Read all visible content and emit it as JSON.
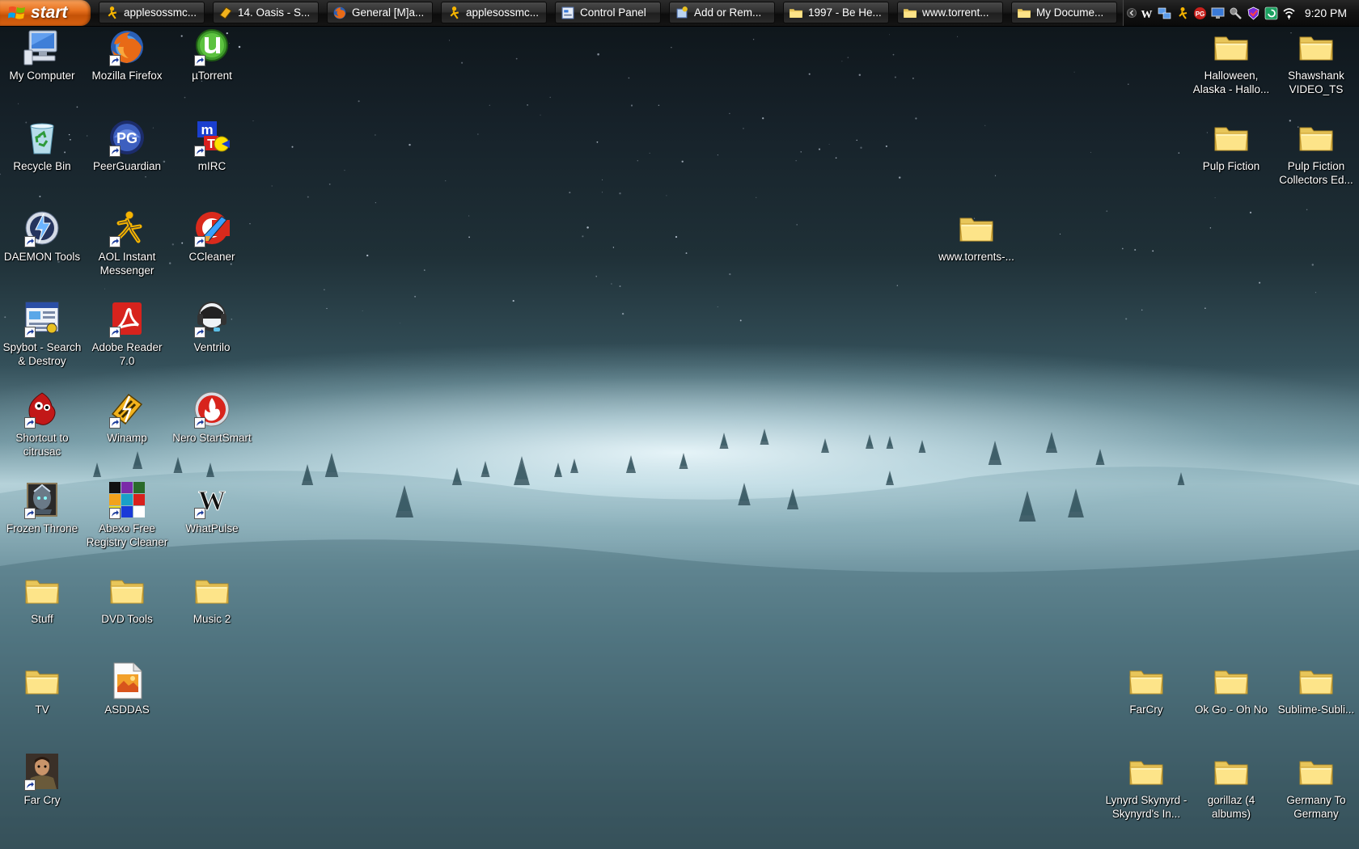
{
  "taskbar": {
    "start_label": "start",
    "buttons": [
      {
        "label": "applesossmc...",
        "icon": "aim-icon"
      },
      {
        "label": "14. Oasis - S...",
        "icon": "winamp-icon"
      },
      {
        "label": "General [M]a...",
        "icon": "firefox-icon"
      },
      {
        "label": "applesossmc...",
        "icon": "aim-chat-icon"
      },
      {
        "label": "Control Panel",
        "icon": "control-panel-icon"
      },
      {
        "label": "Add or Rem...",
        "icon": "add-remove-icon"
      },
      {
        "label": "1997 - Be He...",
        "icon": "folder-icon"
      },
      {
        "label": "www.torrent...",
        "icon": "folder-icon"
      },
      {
        "label": "My Docume...",
        "icon": "folder-icon"
      }
    ],
    "tray": {
      "icons": [
        "whatpulse-icon",
        "network-icon",
        "aim-icon",
        "peerguardian-icon",
        "monitor-icon",
        "antivirus-icon",
        "security-icon",
        "update-icon",
        "wireless-icon"
      ],
      "clock": "9:20 PM"
    }
  },
  "desktop": {
    "icons": [
      {
        "label": "My Computer",
        "icon": "my-computer-icon",
        "shortcut": false
      },
      {
        "label": "Mozilla Firefox",
        "icon": "firefox-icon",
        "shortcut": true
      },
      {
        "label": "µTorrent",
        "icon": "utorrent-icon",
        "shortcut": true
      },
      {
        "label": "Recycle Bin",
        "icon": "recycle-bin-icon",
        "shortcut": false
      },
      {
        "label": "PeerGuardian",
        "icon": "peerguardian-icon",
        "shortcut": true
      },
      {
        "label": "mIRC",
        "icon": "mirc-icon",
        "shortcut": true
      },
      {
        "label": "DAEMON Tools",
        "icon": "daemon-tools-icon",
        "shortcut": true
      },
      {
        "label": "AOL Instant Messenger",
        "icon": "aim-icon",
        "shortcut": true
      },
      {
        "label": "CCleaner",
        "icon": "ccleaner-icon",
        "shortcut": true
      },
      {
        "label": "Spybot - Search & Destroy",
        "icon": "spybot-icon",
        "shortcut": true
      },
      {
        "label": "Adobe Reader 7.0",
        "icon": "adobe-reader-icon",
        "shortcut": true
      },
      {
        "label": "Ventrilo",
        "icon": "ventrilo-icon",
        "shortcut": true
      },
      {
        "label": "Shortcut to citrusac",
        "icon": "citrusac-icon",
        "shortcut": true
      },
      {
        "label": "Winamp",
        "icon": "winamp-icon",
        "shortcut": true
      },
      {
        "label": "Nero StartSmart",
        "icon": "nero-icon",
        "shortcut": true
      },
      {
        "label": "Frozen Throne",
        "icon": "frozen-throne-icon",
        "shortcut": true
      },
      {
        "label": "Abexo Free Registry Cleaner",
        "icon": "registry-cleaner-icon",
        "shortcut": true
      },
      {
        "label": "WhatPulse",
        "icon": "whatpulse-icon",
        "shortcut": true
      },
      {
        "label": "Stuff",
        "icon": "folder-icon",
        "shortcut": false
      },
      {
        "label": "DVD Tools",
        "icon": "folder-icon",
        "shortcut": false
      },
      {
        "label": "Music 2",
        "icon": "folder-icon",
        "shortcut": false
      },
      {
        "label": "TV",
        "icon": "folder-icon",
        "shortcut": false
      },
      {
        "label": "ASDDAS",
        "icon": "image-file-icon",
        "shortcut": false
      },
      {
        "label": "Far Cry",
        "icon": "far-cry-icon",
        "shortcut": true
      },
      {
        "label": "Halloween, Alaska - Hallo...",
        "icon": "folder-icon",
        "shortcut": false
      },
      {
        "label": "Shawshank VIDEO_TS",
        "icon": "folder-icon",
        "shortcut": false
      },
      {
        "label": "Pulp Fiction",
        "icon": "folder-icon",
        "shortcut": false
      },
      {
        "label": "Pulp Fiction Collectors Ed...",
        "icon": "folder-icon",
        "shortcut": false
      },
      {
        "label": "www.torrents-...",
        "icon": "folder-icon",
        "shortcut": false
      },
      {
        "label": "FarCry",
        "icon": "folder-icon",
        "shortcut": false
      },
      {
        "label": "Ok Go - Oh No",
        "icon": "folder-icon",
        "shortcut": false
      },
      {
        "label": "Sublime-Subli...",
        "icon": "folder-icon",
        "shortcut": false
      },
      {
        "label": "Lynyrd Skynyrd - Skynyrd's In...",
        "icon": "folder-icon",
        "shortcut": false
      },
      {
        "label": "gorillaz (4 albums)",
        "icon": "folder-icon",
        "shortcut": false
      },
      {
        "label": "Germany To Germany",
        "icon": "folder-icon",
        "shortcut": false
      }
    ]
  }
}
